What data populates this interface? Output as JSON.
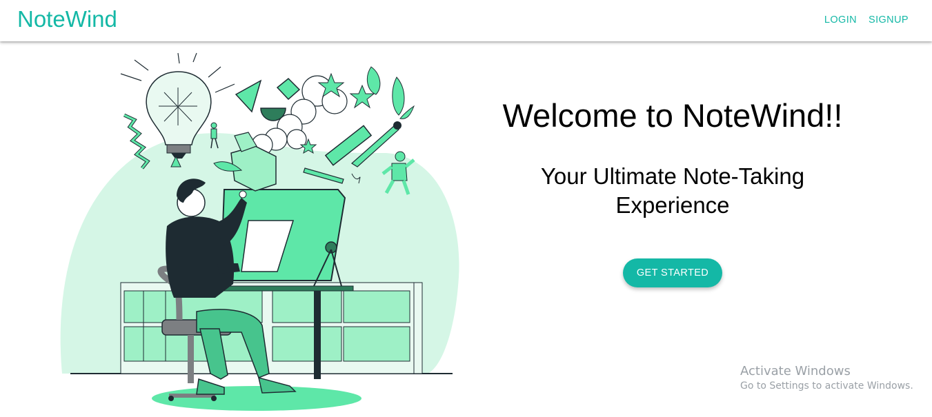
{
  "app": {
    "brand": "NoteWind"
  },
  "nav": {
    "login": "LOGIN",
    "signup": "SIGNUP"
  },
  "hero": {
    "title": "Welcome to NoteWind!!",
    "subtitle": "Your Ultimate Note-Taking Experience",
    "cta_label": "GET STARTED"
  },
  "illustration": {
    "icon": "designer-at-drafting-table-illustration"
  },
  "watermark": {
    "title": "Activate Windows",
    "subtitle": "Go to Settings to activate Windows."
  },
  "colors": {
    "accent": "#14b8a6",
    "illustration_green": "#5ee7a8",
    "illustration_bg": "#d5f6e6",
    "ink": "#1e2b32"
  }
}
